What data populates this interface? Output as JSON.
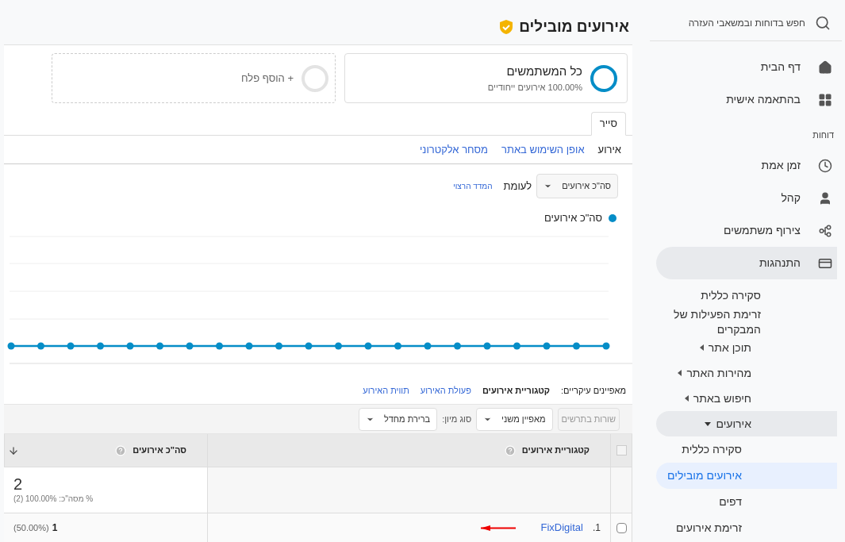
{
  "sidebar": {
    "search": {
      "placeholder": "חפש בדוחות ובמשאבי העזרה"
    },
    "items": [
      {
        "kind": "link",
        "label": "דף הבית",
        "selected": false
      },
      {
        "kind": "link",
        "label": "בהתאמה אישית",
        "selected": false
      },
      {
        "kind": "heading",
        "label": "דוחות"
      },
      {
        "kind": "link",
        "label": "זמן אמת",
        "selected": false
      },
      {
        "kind": "link",
        "label": "קהל",
        "selected": false
      },
      {
        "kind": "link",
        "label": "צירוף משתמשים",
        "selected": false
      },
      {
        "kind": "group",
        "label": "התנהגות",
        "expanded": true,
        "children": [
          {
            "kind": "link",
            "label": "סקירה כללית",
            "selected": false
          },
          {
            "kind": "link",
            "label": "זרימת הפעילות של המבקרים",
            "selected": false
          },
          {
            "kind": "folder",
            "label": "תוכן אתר",
            "expanded": false
          },
          {
            "kind": "folder",
            "label": "מהירות האתר",
            "expanded": false
          },
          {
            "kind": "folder",
            "label": "חיפוש באתר",
            "expanded": false
          },
          {
            "kind": "folder",
            "label": "אירועים",
            "expanded": true,
            "children": [
              {
                "kind": "link",
                "label": "סקירה כללית",
                "selected": false
              },
              {
                "kind": "link",
                "label": "אירועים מובילים",
                "selected": true
              },
              {
                "kind": "link",
                "label": "דפים",
                "selected": false
              },
              {
                "kind": "link",
                "label": "זרימת אירועים",
                "selected": false
              }
            ]
          }
        ]
      }
    ]
  },
  "title": "אירועים מובילים",
  "segments": [
    {
      "kind": "segment",
      "name": "כל המשתמשים",
      "detail": "100.00% אירועים ייחודיים"
    },
    {
      "kind": "add",
      "name": "+ הוסף פלח"
    }
  ],
  "tabs": [
    {
      "label": "סייר",
      "selected": true
    }
  ],
  "subtabs": [
    {
      "label": "אירוע",
      "selected": true
    },
    {
      "label": "אופן השימוש באתר",
      "selected": false
    },
    {
      "label": "מסחר אלקטרוני",
      "selected": false
    }
  ],
  "metric": {
    "select": "סה\"כ אירועים",
    "versus": "לעומת",
    "link": "המדד הרצוי"
  },
  "legend": {
    "label": "סה\"כ אירועים",
    "color": "#058dc7"
  },
  "dimensions": {
    "label": "מאפיינים עיקריים:",
    "options": [
      {
        "label": "קטגוריית אירועים",
        "selected": true
      },
      {
        "label": "פעולת האירוע",
        "selected": false
      },
      {
        "label": "תווית האירוע",
        "selected": false
      }
    ]
  },
  "toolbar": {
    "plot_rows": {
      "label": "שורות בתרשים",
      "disabled": true
    },
    "secondary": "מאפיין משני",
    "sort_label": "סוג מיון:",
    "sort": "ברירת מחדל"
  },
  "table": {
    "select_all": {
      "checked": false
    },
    "columns": [
      {
        "label": "קטגוריית אירועים",
        "sorted": false
      },
      {
        "label": "סה\"כ אירועים",
        "sorted": true
      }
    ],
    "totals": {
      "value": "2",
      "detail": "% מסה\"כ: 100.00% (2)"
    },
    "rows": [
      {
        "index": "1.",
        "label": "FixDigital",
        "value": "1",
        "share": "(50.00%)",
        "checked": false
      }
    ]
  }
}
